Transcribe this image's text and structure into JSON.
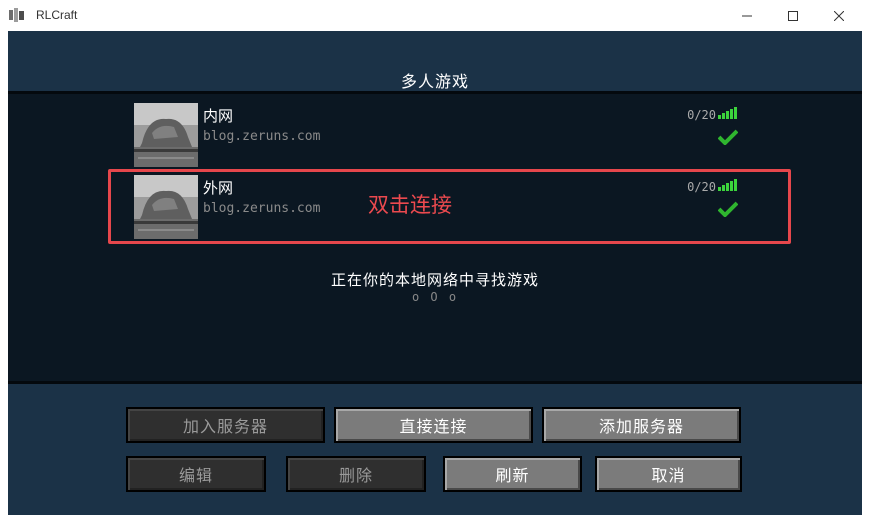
{
  "window": {
    "title": "RLCraft",
    "minimize_icon": "minimize-icon",
    "maximize_icon": "maximize-icon",
    "close_icon": "close-icon"
  },
  "screen": {
    "title": "多人游戏"
  },
  "servers": [
    {
      "name": "内网",
      "motd": "blog.zeruns.com",
      "players": "0/20"
    },
    {
      "name": "外网",
      "motd": "blog.zeruns.com",
      "players": "0/20"
    }
  ],
  "annotation": {
    "text": "双击连接",
    "color": "#e6474c"
  },
  "lan": {
    "searching": "正在你的本地网络中寻找游戏",
    "dots": "o O o"
  },
  "buttons": {
    "join": "加入服务器",
    "direct": "直接连接",
    "add": "添加服务器",
    "edit": "编辑",
    "delete": "删除",
    "refresh": "刷新",
    "cancel": "取消"
  },
  "colors": {
    "signal": "#3cd43c",
    "check": "#2fb52f",
    "background": "#0b1722",
    "band": "#1b3247"
  }
}
